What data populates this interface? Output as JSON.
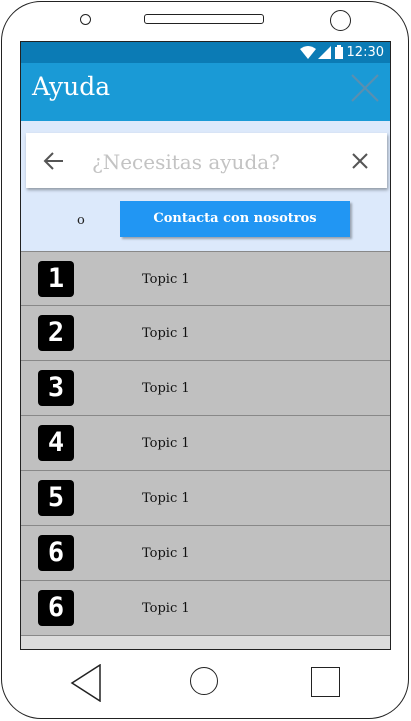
{
  "status": {
    "time": "12:30"
  },
  "appbar": {
    "title": "Ayuda"
  },
  "search": {
    "placeholder": "¿Necesitas ayuda?"
  },
  "contact": {
    "or_label": "o",
    "button_label": "Contacta con nosotros"
  },
  "topics": [
    {
      "number": "1",
      "label": "Topic 1"
    },
    {
      "number": "2",
      "label": "Topic 1"
    },
    {
      "number": "3",
      "label": "Topic 1"
    },
    {
      "number": "4",
      "label": "Topic 1"
    },
    {
      "number": "5",
      "label": "Topic 1"
    },
    {
      "number": "6",
      "label": "Topic 1"
    },
    {
      "number": "6",
      "label": "Topic 1"
    }
  ],
  "colors": {
    "statusbar": "#0b7bb5",
    "appbar": "#1a9ad6",
    "accent": "#2196f3",
    "help_bg": "#dce9fb",
    "list_bg": "#c0c0c0"
  }
}
